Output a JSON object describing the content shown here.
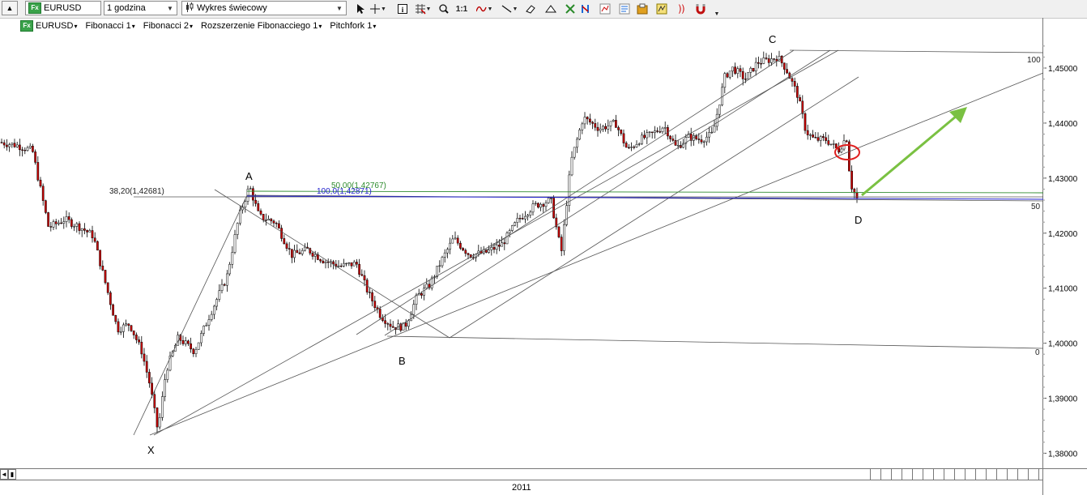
{
  "toolbar": {
    "symbol": "EURUSD",
    "timeframe": "1 godzina",
    "chart_type": "Wykres świecowy",
    "zoom_label": "1:1",
    "fx_badge": "Fx"
  },
  "sub_toolbar": {
    "items": [
      "EURUSD",
      "Fibonacci 1",
      "Fibonacci 2",
      "Rozszerzenie Fibonacciego 1",
      "Pitchfork 1"
    ]
  },
  "chart": {
    "price_labels": [
      "1,45000",
      "1,44000",
      "1,43000",
      "1,42000",
      "1,41000",
      "1,40000",
      "1,39000",
      "1,38000"
    ],
    "points": {
      "x": "X",
      "a": "A",
      "b": "B",
      "c": "C",
      "d": "D"
    },
    "fib_labels": {
      "level_38": "38,20(1,42681)",
      "level_50": "50,00(1,42767)",
      "level_100": "100,0(1,42871)",
      "pitch_100": "100",
      "pitch_50": "50",
      "pitch_0": "0"
    },
    "year_label": "2011",
    "colors": {
      "bull": "#ffffff",
      "bear": "#cc0000",
      "fib_green": "#2e8b2e",
      "fib_blue": "#1f1fcc",
      "arrow": "#7ac142",
      "circle": "#e02020"
    }
  },
  "chart_data": {
    "type": "candlestick",
    "title": "",
    "xlabel": "2011",
    "ylabel": "",
    "ylim": [
      1.3775,
      1.4605
    ],
    "y_ticks": [
      1.45,
      1.44,
      1.43,
      1.42,
      1.41,
      1.4,
      1.39,
      1.38
    ],
    "swing_points": [
      {
        "label": "X",
        "price": 1.3835
      },
      {
        "label": "A",
        "price": 1.429
      },
      {
        "label": "B",
        "price": 1.4015
      },
      {
        "label": "C",
        "price": 1.4545
      },
      {
        "label": "D",
        "price": 1.4255
      }
    ],
    "annotations": [
      "38,20(1,42681)",
      "50,00(1,42767)",
      "100,0(1,42871)",
      "100",
      "50",
      "0"
    ]
  }
}
